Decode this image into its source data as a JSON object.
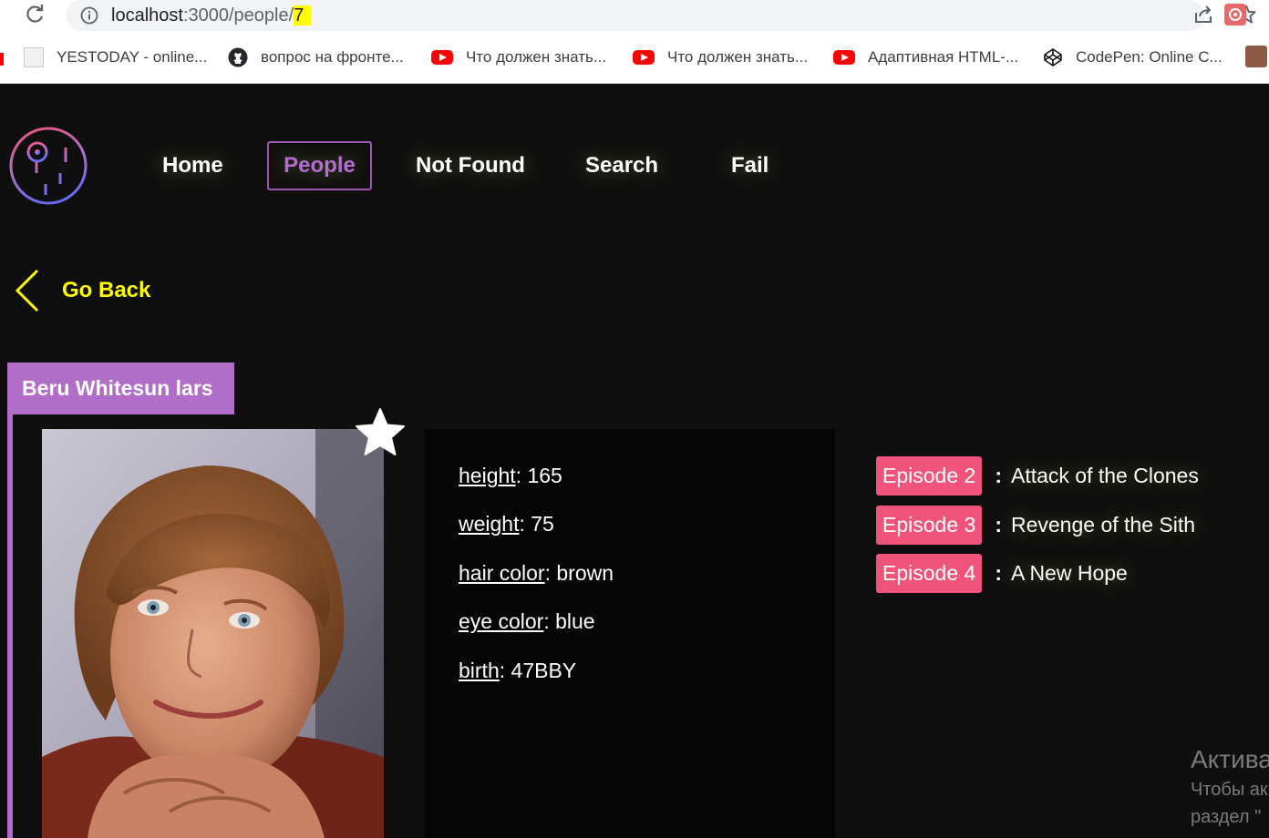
{
  "browser": {
    "url_host": "localhost",
    "url_path": ":3000/people/",
    "url_highlight": "7",
    "bookmarks": [
      {
        "label": "YESTODAY - online...",
        "icon": "page-icon"
      },
      {
        "label": "вопрос на фронте...",
        "icon": "github-icon"
      },
      {
        "label": "Что должен знать...",
        "icon": "youtube-icon"
      },
      {
        "label": "Что должен знать...",
        "icon": "youtube-icon"
      },
      {
        "label": "Адаптивная HTML-...",
        "icon": "youtube-icon"
      },
      {
        "label": "CodePen: Online C...",
        "icon": "codepen-icon"
      }
    ]
  },
  "nav": {
    "items": [
      "Home",
      "People",
      "Not Found",
      "Search",
      "Fail"
    ],
    "active": "People"
  },
  "go_back": "Go Back",
  "person": {
    "name": "Beru Whitesun lars",
    "details": [
      {
        "key": "height",
        "value": ": 165"
      },
      {
        "key": "weight",
        "value": ": 75"
      },
      {
        "key": "hair color",
        "value": ": brown"
      },
      {
        "key": "eye color",
        "value": ": blue"
      },
      {
        "key": "birth",
        "value": ": 47BBY"
      }
    ],
    "episodes": [
      {
        "badge": "Episode 2",
        "sep": ":",
        "title": "Attack of the Clones"
      },
      {
        "badge": "Episode 3",
        "sep": ":",
        "title": "Revenge of the Sith"
      },
      {
        "badge": "Episode 4",
        "sep": ":",
        "title": "A New Hope"
      }
    ]
  },
  "colors": {
    "accent_purple": "#b06ec8",
    "go_back_yellow": "#ffff00",
    "episode_pink": "#f0547a"
  },
  "os_watermark": {
    "line1": "Актива",
    "line2": "Чтобы ак",
    "line3": "раздел \""
  }
}
